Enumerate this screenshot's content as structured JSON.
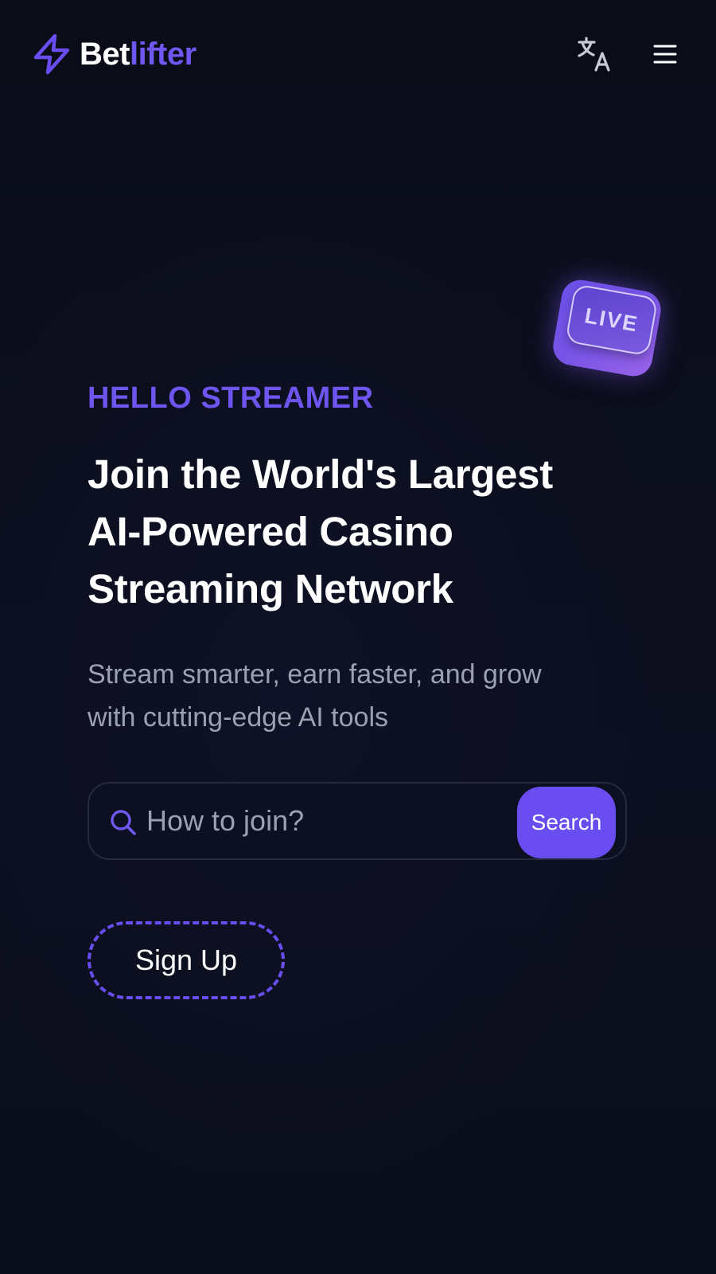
{
  "header": {
    "brand_part1": "Bet",
    "brand_part2": "lifter",
    "logo_icon": "lightning-bolt-icon",
    "translate_icon": "translate-icon",
    "menu_icon": "hamburger-menu-icon"
  },
  "hero": {
    "badge_label": "LIVE",
    "eyebrow": "HELLO STREAMER",
    "headline_lines": [
      "Join the World's Largest",
      "AI-Powered Casino",
      "Streaming Network"
    ],
    "subtitle_lines": [
      "Stream smarter, earn faster, and grow",
      "with cutting-edge AI tools"
    ]
  },
  "search": {
    "icon": "search-icon",
    "placeholder": "How to join?",
    "value": "",
    "button_label": "Search"
  },
  "cta": {
    "signup_label": "Sign Up"
  },
  "colors": {
    "background": "#0b0d1b",
    "accent": "#6a4df0",
    "eyebrow": "#6e55ef",
    "muted_text": "#9ba0b2",
    "heading_text": "#ffffff"
  }
}
